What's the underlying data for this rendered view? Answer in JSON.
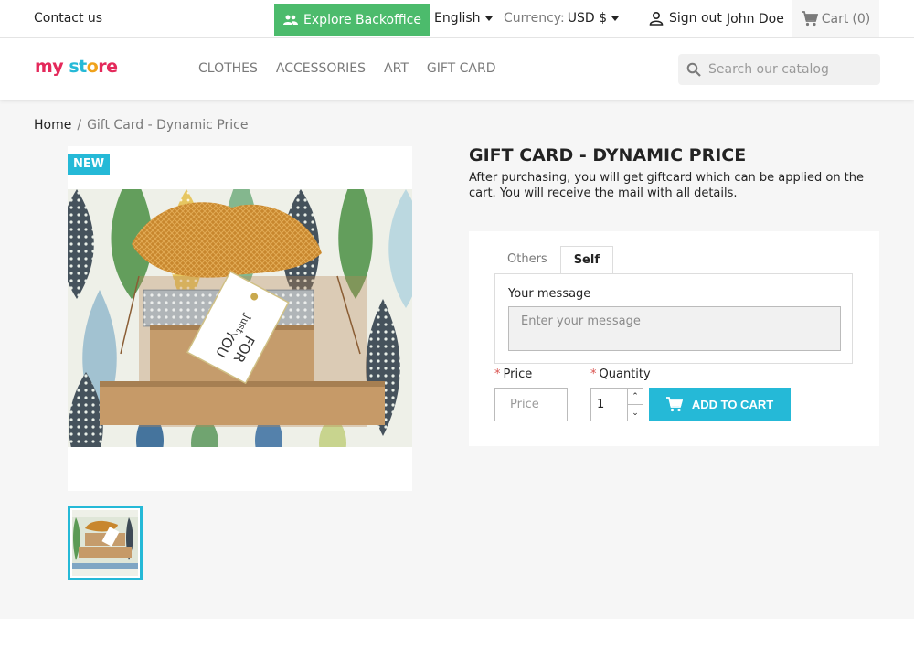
{
  "topbar": {
    "contact": "Contact us",
    "explore_backoffice": "Explore Backoffice",
    "language": "English",
    "currency_label": "Currency:",
    "currency_value": "USD $",
    "sign_out": "Sign out",
    "user_name": "John Doe",
    "cart": "Cart",
    "cart_count": "(0)"
  },
  "header": {
    "logo_parts": [
      "my",
      " ",
      "st",
      "o",
      "re"
    ],
    "nav": [
      "CLOTHES",
      "ACCESSORIES",
      "ART",
      "GIFT CARD"
    ],
    "search_placeholder": "Search our catalog"
  },
  "breadcrumb": {
    "home": "Home",
    "separator": "/",
    "current": "Gift Card - Dynamic Price"
  },
  "product": {
    "badge": "NEW",
    "title": "GIFT CARD - DYNAMIC PRICE",
    "description": "After purchasing, you will get giftcard which can be applied on the cart. You will receive the mail with all details.",
    "tag_text": [
      "Just",
      "FOR",
      "YOU"
    ]
  },
  "form": {
    "tabs": [
      {
        "label": "Others",
        "active": false
      },
      {
        "label": "Self",
        "active": true
      }
    ],
    "message_label": "Your message",
    "message_placeholder": "Enter your message",
    "price_label": "Price",
    "price_placeholder": "Price",
    "quantity_label": "Quantity",
    "quantity_value": "1",
    "add_to_cart": "ADD TO CART",
    "required_mark": "*"
  },
  "colors": {
    "accent": "#25b9d7",
    "backoffice": "#4cbb6c",
    "required": "#d9534f"
  }
}
